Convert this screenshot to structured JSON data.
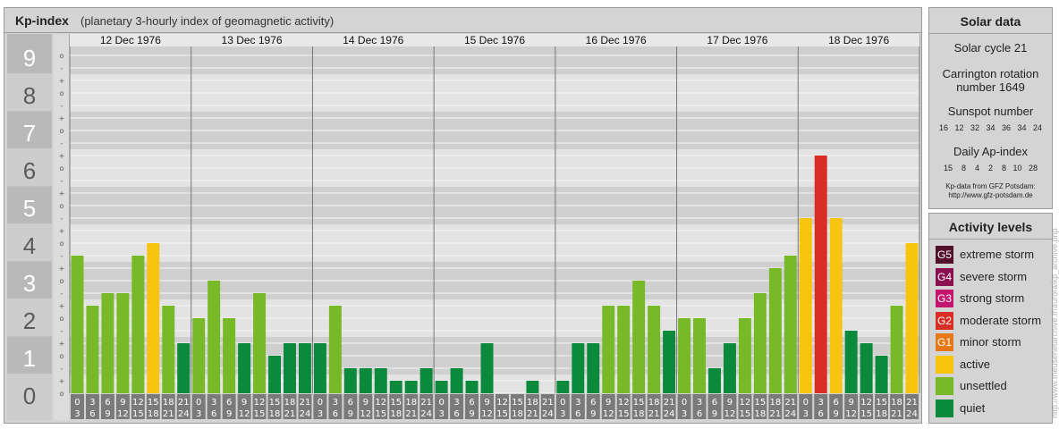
{
  "header": {
    "title": "Kp-index",
    "subtitle": "(planetary 3-hourly index of geomagnetic activity)"
  },
  "chart_data": {
    "type": "bar",
    "ylim": [
      0,
      9
    ],
    "y_ticks": [
      "0",
      "1",
      "2",
      "3",
      "4",
      "5",
      "6",
      "7",
      "8",
      "9"
    ],
    "minor_labels": [
      "o",
      "+",
      "-"
    ],
    "days": [
      "12 Dec 1976",
      "13 Dec 1976",
      "14 Dec 1976",
      "15 Dec 1976",
      "16 Dec 1976",
      "17 Dec 1976",
      "18 Dec 1976"
    ],
    "hour_labels": [
      [
        "0",
        "3"
      ],
      [
        "3",
        "6"
      ],
      [
        "6",
        "9"
      ],
      [
        "9",
        "12"
      ],
      [
        "12",
        "15"
      ],
      [
        "15",
        "18"
      ],
      [
        "18",
        "21"
      ],
      [
        "21",
        "24"
      ]
    ],
    "values": [
      3.667,
      2.333,
      2.667,
      2.667,
      3.667,
      4.0,
      2.333,
      1.333,
      2.0,
      3.0,
      2.0,
      1.333,
      2.667,
      1.0,
      1.333,
      1.333,
      1.333,
      2.333,
      0.667,
      0.667,
      0.667,
      0.333,
      0.333,
      0.667,
      0.333,
      0.667,
      0.333,
      1.333,
      0.0,
      0.0,
      0.333,
      0.0,
      0.333,
      1.333,
      1.333,
      2.333,
      2.333,
      3.0,
      2.333,
      1.667,
      2.0,
      2.0,
      0.667,
      1.333,
      2.0,
      2.667,
      3.333,
      3.667,
      4.667,
      6.333,
      4.667,
      1.667,
      1.333,
      1.0,
      2.333,
      4.0
    ],
    "colors": {
      "quiet": "#0c8a3c",
      "unsettled": "#78b928",
      "active": "#f7c40f",
      "minor_storm": "#e77817",
      "moderate_storm": "#d82e25",
      "strong_storm": "#c2156e",
      "severe_storm": "#8a1050",
      "extreme_storm": "#53102b"
    }
  },
  "solar_data": {
    "title": "Solar data",
    "solar_cycle": "Solar cycle 21",
    "carrington_line1": "Carrington rotation",
    "carrington_line2": "number 1649",
    "sunspot_label": "Sunspot number",
    "sunspot_values": "16   12   32   34   36   34   24",
    "ap_label": "Daily Ap-index",
    "ap_values": "15    8    4    2    8   10   28",
    "source_line1": "Kp-data from GFZ Potsdam:",
    "source_line2": "http://www.gfz-potsdam.de"
  },
  "activity_levels": {
    "title": "Activity levels",
    "items": [
      {
        "badge": "G5",
        "label": "extreme storm",
        "color": "#53102b"
      },
      {
        "badge": "G4",
        "label": "severe storm",
        "color": "#8a1050"
      },
      {
        "badge": "G3",
        "label": "strong storm",
        "color": "#c2156e"
      },
      {
        "badge": "G2",
        "label": "moderate storm",
        "color": "#d82e25"
      },
      {
        "badge": "G1",
        "label": "minor storm",
        "color": "#e77817"
      },
      {
        "badge": "",
        "label": "active",
        "color": "#f7c40f"
      },
      {
        "badge": "",
        "label": "unsettled",
        "color": "#78b928"
      },
      {
        "badge": "",
        "label": "quiet",
        "color": "#0c8a3c"
      }
    ]
  },
  "credit": "http://www.theusenetarchive.fr/aurora/kp_archive.php"
}
